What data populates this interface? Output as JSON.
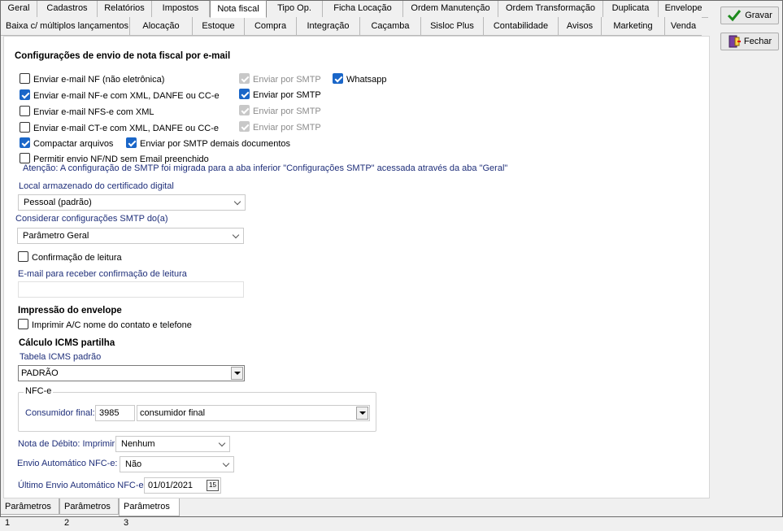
{
  "tabs_row1": [
    "Geral",
    "Cadastros",
    "Relatórios",
    "Impostos",
    "Nota fiscal",
    "Tipo Op.",
    "Ficha Locação",
    "Ordem Manutenção",
    "Ordem Transformação",
    "Duplicata",
    "Envelope"
  ],
  "tabs_row2": [
    "Baixa c/ múltiplos lançamentos",
    "Alocação",
    "Estoque",
    "Compra",
    "Integração",
    "Caçamba",
    "Sisloc Plus",
    "Contabilidade",
    "Avisos",
    "Marketing",
    "Venda"
  ],
  "buttons": {
    "save": "Gravar",
    "close": "Fechar"
  },
  "email": {
    "title": "Configurações de envio de nota fiscal por e-mail",
    "nf": "Enviar e-mail NF (não eletrônica)",
    "nfe": "Enviar e-mail NF-e com XML, DANFE ou CC-e",
    "nfse": "Enviar e-mail NFS-e com XML",
    "cte": "Enviar e-mail CT-e com XML, DANFE ou CC-e",
    "smtp": "Enviar por SMTP",
    "whatsapp": "Whatsapp",
    "compact": "Compactar arquivos",
    "smtp_other": "Enviar por SMTP demais documentos",
    "allow_no_email": "Permitir envio NF/ND sem Email preenchido",
    "warning": "Atenção: A configuração de SMTP foi migrada para a aba inferior \"Configurações SMTP\" acessada através da aba \"Geral\""
  },
  "cert": {
    "label": "Local armazenado do certificado digital",
    "value": "Pessoal (padrão)"
  },
  "smtp_cfg": {
    "label": "Considerar configurações SMTP do(a)",
    "value": "Parâmetro Geral"
  },
  "read_confirm": "Confirmação de leitura",
  "read_email_label": "E-mail para receber confirmação de leitura",
  "read_email_value": "",
  "envelope": {
    "title": "Impressão do envelope",
    "print_ac": "Imprimir A/C nome do contato e telefone"
  },
  "icms": {
    "title": "Cálculo ICMS partilha",
    "table_label": "Tabela ICMS padrão",
    "table_value": "PADRÃO"
  },
  "nfce": {
    "group": "NFC-e",
    "consumer_label": "Consumidor final:",
    "consumer_code": "3985",
    "consumer_name": "consumidor final"
  },
  "debit_note": {
    "label": "Nota de Débito: Imprimir",
    "value": "Nenhum"
  },
  "auto_nfce": {
    "label": "Envio Automático NFC-e:",
    "value": "Não"
  },
  "last_auto": {
    "label": "Último Envio Automático NFC-e:",
    "value": "01/01/2021",
    "cal_text": "15"
  },
  "bottom_tabs": [
    "Parâmetros 1",
    "Parâmetros 2",
    "Parâmetros 3"
  ],
  "colors": {
    "check": "#1a66c8",
    "label_blue": "#1f2f7a"
  }
}
